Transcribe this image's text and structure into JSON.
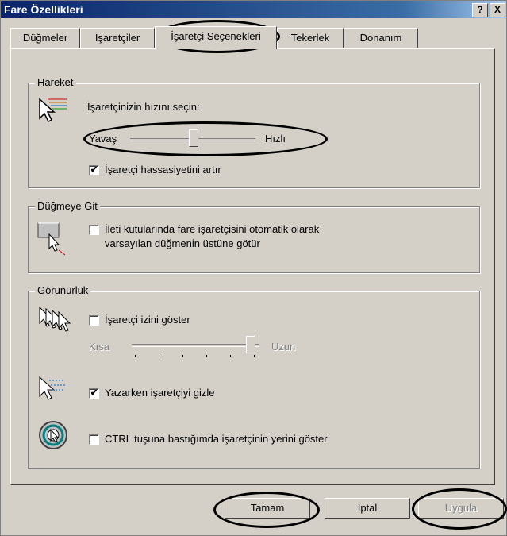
{
  "window": {
    "title": "Fare Özellikleri",
    "help_label": "?",
    "close_label": "X"
  },
  "tabs": [
    {
      "label": "Düğmeler"
    },
    {
      "label": "İşaretçiler"
    },
    {
      "label": "İşaretçi Seçenekleri",
      "active": true
    },
    {
      "label": "Tekerlek"
    },
    {
      "label": "Donanım"
    }
  ],
  "motion": {
    "legend": "Hareket",
    "prompt": "İşaretçinizin hızını seçin:",
    "slow_label": "Yavaş",
    "fast_label": "Hızlı",
    "speed_fraction": 0.5,
    "precision_label": "İşaretçi hassasiyetini artır",
    "precision_checked": true
  },
  "snap": {
    "legend": "Düğmeye Git",
    "label_line1": "İleti kutularında fare işaretçisini otomatik olarak",
    "label_line2": "varsayılan düğmenin üstüne götür",
    "checked": false
  },
  "visibility": {
    "legend": "Görünürlük",
    "trails_label": "İşaretçi izini göster",
    "trails_checked": false,
    "short_label": "Kısa",
    "long_label": "Uzun",
    "trail_fraction": 1.0,
    "hide_label": "Yazarken işaretçiyi gizle",
    "hide_checked": true,
    "ctrl_label": "CTRL tuşuna bastığımda işaretçinin yerini göster",
    "ctrl_checked": false
  },
  "buttons": {
    "ok": "Tamam",
    "cancel": "İptal",
    "apply": "Uygula"
  },
  "colors": {
    "titlebar": "#0a246a",
    "face": "#d4d0c8"
  }
}
